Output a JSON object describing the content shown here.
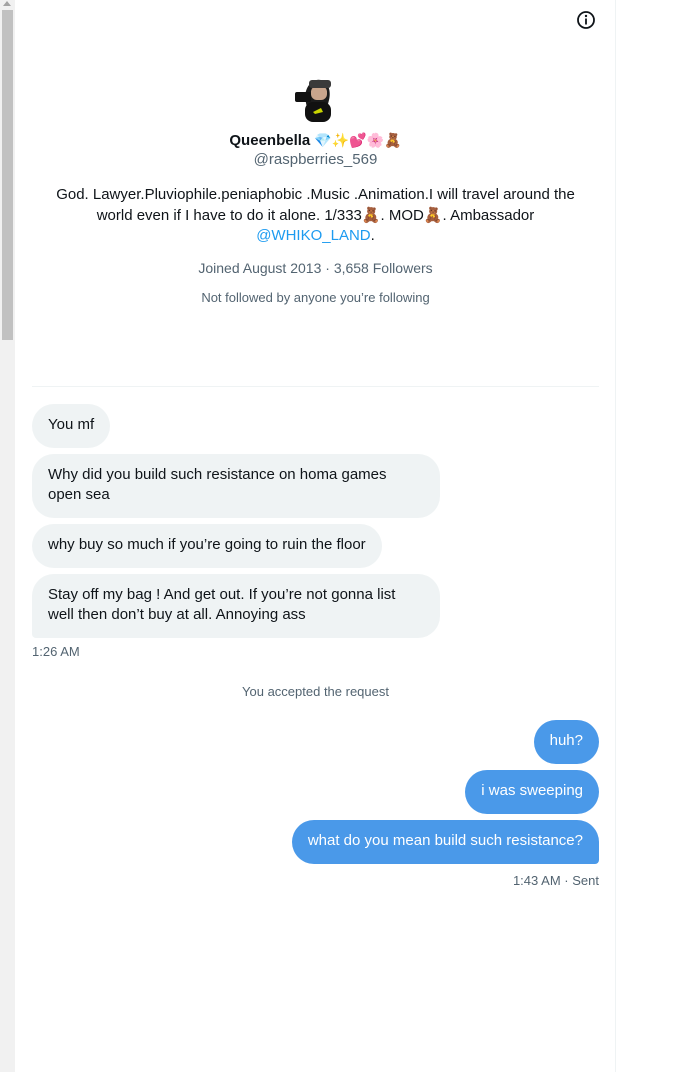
{
  "profile": {
    "avatar_icon": "cartoon-avatar-icon",
    "display_name": "Queenbella",
    "name_emojis": "💎✨💕🌸🧸",
    "handle": "@raspberries_569",
    "bio_text": "God. Lawyer.Pluviophile.peniaphobic .Music .Animation.I will travel around the world even if I have to do it alone. 1/333🧸. MOD🧸. Ambassador ",
    "bio_link": "@WHIKO_LAND",
    "bio_end": ".",
    "joined": "Joined August 2013",
    "separator": "·",
    "followers": "3,658 Followers",
    "not_followed": "Not followed by anyone you’re following"
  },
  "header": {
    "info_icon": "info-icon"
  },
  "messages": {
    "incoming": [
      "You mf",
      "Why did you build such resistance on homa games open sea",
      "why buy so much if you’re going to ruin the floor",
      "Stay off my bag ! And get out. If you’re not gonna list well then don’t buy at all. Annoying ass"
    ],
    "incoming_time": "1:26 AM",
    "system_note": "You accepted the request",
    "outgoing": [
      "huh?",
      "i was sweeping",
      "what do you mean build such resistance?"
    ],
    "outgoing_time": "1:43 AM",
    "outgoing_status": "Sent"
  },
  "colors": {
    "incoming_bg": "#eff3f4",
    "outgoing_bg": "#4a99e9",
    "link": "#1d9bf0",
    "secondary_text": "#536471"
  }
}
